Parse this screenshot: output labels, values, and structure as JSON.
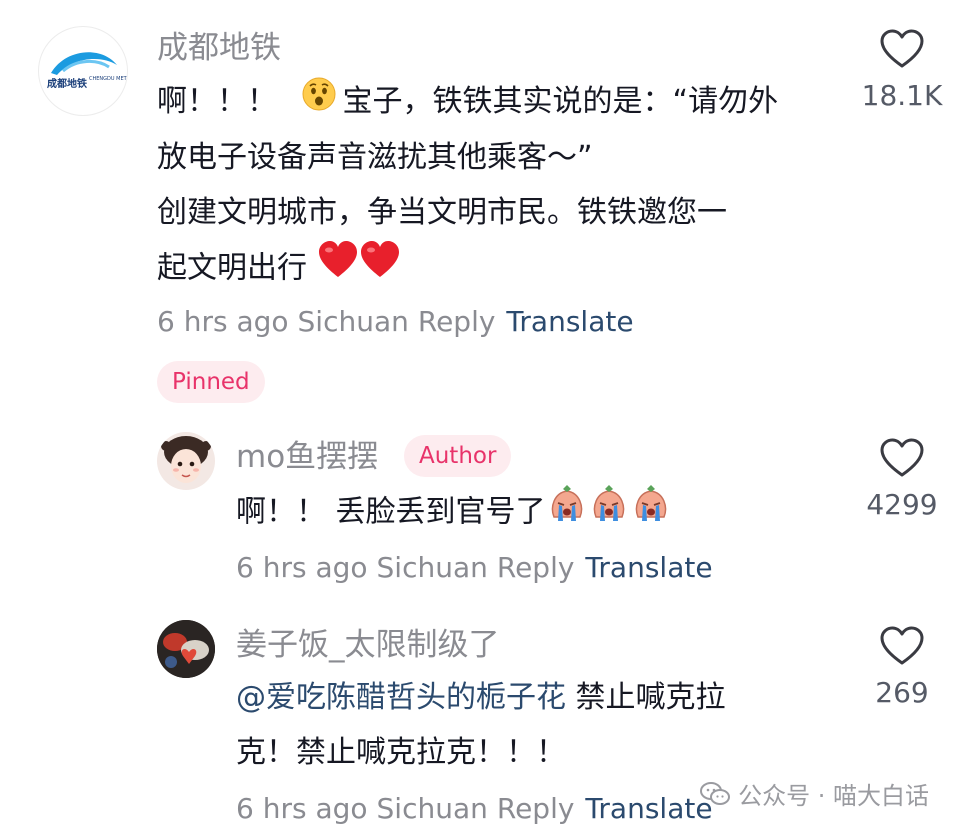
{
  "comments": [
    {
      "username": "成都地铁",
      "avatar_text": "成都地铁",
      "avatar_sub": "CHENGDU METRO",
      "line1_prefix": "啊！！！",
      "line1_suffix": "宝子，铁铁其实说的是：“请勿外",
      "line2": "放电子设备声音滋扰其他乘客～”",
      "line3": "创建文明城市，争当文明市民。铁铁邀您一",
      "line4": "起文明出行",
      "time": "6 hrs ago",
      "location": "Sichuan",
      "reply": "Reply",
      "translate": "Translate",
      "likes": "18.1K",
      "pinned": "Pinned"
    },
    {
      "username": "mo鱼摆摆",
      "badge": "Author",
      "text": "啊！！ 丢脸丢到官号了",
      "time": "6 hrs ago",
      "location": "Sichuan",
      "reply": "Reply",
      "translate": "Translate",
      "likes": "4299"
    },
    {
      "username": "姜子饭_太限制级了",
      "mention": "@爱吃陈醋哲头的栀子花",
      "line1_rest": " 禁止喊克拉",
      "line2": "克！禁止喊克拉克！！！",
      "time": "6 hrs ago",
      "location": "Sichuan",
      "reply": "Reply",
      "translate": "Translate",
      "likes": "269"
    }
  ],
  "watermark": {
    "text": "公众号 · 喵大白话",
    "icon": "wechat-icon"
  },
  "colors": {
    "meta_gray": "#8a8b91",
    "translate_blue": "#2b4a6e",
    "pinned_pink": "#e8336a",
    "pinned_bg": "#fdecef"
  }
}
